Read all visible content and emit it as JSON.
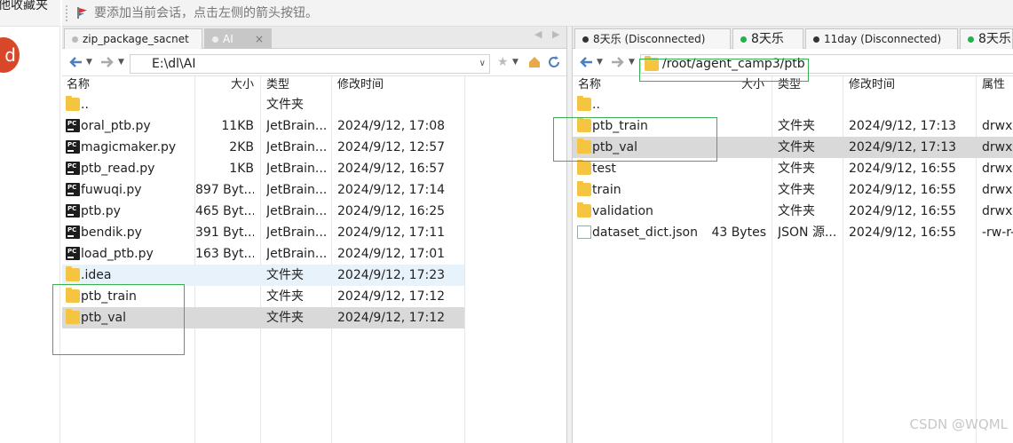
{
  "left_strip": {
    "fragment": "他收藏夹",
    "avatar_letter": "d"
  },
  "notice": {
    "text": "要添加当前会话，点击左侧的箭头按钮。"
  },
  "left_tabs": [
    {
      "label": "zip_package_sacnet",
      "active": false
    },
    {
      "label": "AI",
      "active": true,
      "close": "×"
    }
  ],
  "right_tabs": [
    {
      "label": "8天乐 (Disconnected)",
      "dot_color": "#333333"
    },
    {
      "label": "8天乐",
      "dot_color": "#22b14c"
    },
    {
      "label": "11day (Disconnected)",
      "dot_color": "#333333"
    },
    {
      "label": "8天乐",
      "dot_color": "#22b14c"
    }
  ],
  "tab_nav": {
    "left": "◀",
    "right": "▶"
  },
  "left_pane": {
    "path": "E:\\dl\\AI",
    "headers": {
      "name": "名称",
      "size": "大小",
      "type": "类型",
      "mtime": "修改时间"
    },
    "rows": [
      {
        "name": "..",
        "size": "",
        "type": "文件夹",
        "mtime": "",
        "icon": "folder"
      },
      {
        "name": "oral_ptb.py",
        "size": "11KB",
        "type": "JetBrain...",
        "mtime": "2024/9/12, 17:08",
        "icon": "py"
      },
      {
        "name": "magicmaker.py",
        "size": "2KB",
        "type": "JetBrain...",
        "mtime": "2024/9/12, 12:57",
        "icon": "py"
      },
      {
        "name": "ptb_read.py",
        "size": "1KB",
        "type": "JetBrain...",
        "mtime": "2024/9/12, 16:57",
        "icon": "py"
      },
      {
        "name": "fuwuqi.py",
        "size": "897 Byt...",
        "type": "JetBrain...",
        "mtime": "2024/9/12, 17:14",
        "icon": "py"
      },
      {
        "name": "ptb.py",
        "size": "465 Byt...",
        "type": "JetBrain...",
        "mtime": "2024/9/12, 16:25",
        "icon": "py"
      },
      {
        "name": "bendik.py",
        "size": "391 Byt...",
        "type": "JetBrain...",
        "mtime": "2024/9/12, 17:11",
        "icon": "py"
      },
      {
        "name": "load_ptb.py",
        "size": "163 Byt...",
        "type": "JetBrain...",
        "mtime": "2024/9/12, 17:01",
        "icon": "py"
      },
      {
        "name": ".idea",
        "size": "",
        "type": "文件夹",
        "mtime": "2024/9/12, 17:23",
        "icon": "folder",
        "state": "hover"
      },
      {
        "name": "ptb_train",
        "size": "",
        "type": "文件夹",
        "mtime": "2024/9/12, 17:12",
        "icon": "folder"
      },
      {
        "name": "ptb_val",
        "size": "",
        "type": "文件夹",
        "mtime": "2024/9/12, 17:12",
        "icon": "folder",
        "state": "selected"
      }
    ]
  },
  "right_pane": {
    "path": "/root/agent_camp3/ptb",
    "headers": {
      "name": "名称",
      "size": "大小",
      "type": "类型",
      "mtime": "修改时间",
      "attr": "属性"
    },
    "rows": [
      {
        "name": "..",
        "size": "",
        "type": "",
        "mtime": "",
        "attr": "",
        "icon": "folder"
      },
      {
        "name": "ptb_train",
        "size": "",
        "type": "文件夹",
        "mtime": "2024/9/12, 17:13",
        "attr": "drwxr",
        "icon": "folder"
      },
      {
        "name": "ptb_val",
        "size": "",
        "type": "文件夹",
        "mtime": "2024/9/12, 17:13",
        "attr": "drwxr",
        "icon": "folder",
        "state": "selected"
      },
      {
        "name": "test",
        "size": "",
        "type": "文件夹",
        "mtime": "2024/9/12, 16:55",
        "attr": "drwxr",
        "icon": "folder"
      },
      {
        "name": "train",
        "size": "",
        "type": "文件夹",
        "mtime": "2024/9/12, 16:55",
        "attr": "drwxr",
        "icon": "folder"
      },
      {
        "name": "validation",
        "size": "",
        "type": "文件夹",
        "mtime": "2024/9/12, 16:55",
        "attr": "drwxr",
        "icon": "folder"
      },
      {
        "name": "dataset_dict.json",
        "size": "43 Bytes",
        "type": "JSON 源...",
        "mtime": "2024/9/12, 16:55",
        "attr": "-rw-r-",
        "icon": "file"
      }
    ]
  },
  "watermark": "CSDN @WQML",
  "colors": {
    "highlight_box": "#3cae55",
    "selected_row": "#d9d9d9",
    "hover_row": "#e8f2fb",
    "folder": "#f5c542",
    "error_avatar": "#d9472b"
  }
}
